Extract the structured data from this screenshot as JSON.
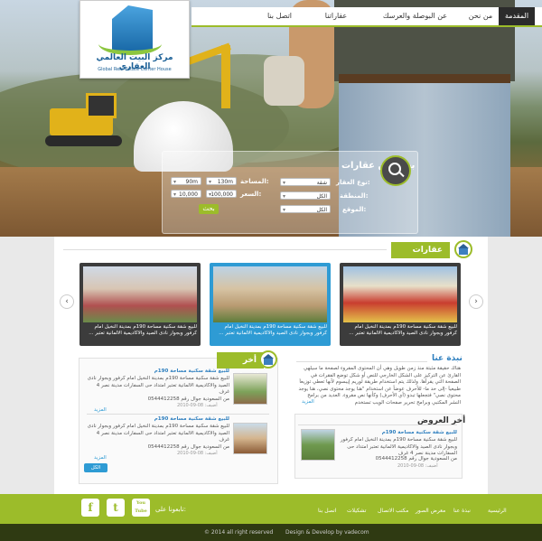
{
  "nav": {
    "items": [
      "المقدمة",
      "من نحن",
      "عن البوصلة والعرسك",
      "عقاراتنا",
      "اتصل بنا"
    ],
    "active": 0
  },
  "logo": {
    "arabic": "مركز البيت العالمي العقاري",
    "english": "Global Real Estate Center House"
  },
  "search": {
    "title": "بحث عن عقارات",
    "type_label": "نوع العقار:",
    "type_value": "شقة",
    "area_label": "المنطقة:",
    "area_value": "الكل",
    "location_label": "الموقع:",
    "location_value": "الكل",
    "space_label": "المساحة:",
    "space_from": "130m",
    "space_to": "90m",
    "price_label": "السعر:",
    "price_from": "100,000",
    "price_to": "10,000",
    "button": "بحث"
  },
  "featured": {
    "title": "عقارات مميزة",
    "cards": [
      {
        "text": "للبيع شقة سكنية مساحة 190م بمدينة النخيل امام كرفور وبجوار نادى الصيد والاكاديمية الالمانية تعتبر ..."
      },
      {
        "text": "للبيع شقة سكنية مساحة 190م بمدينة النخيل امام كرفور وبجوار نادى الصيد والاكاديمية الالمانية تعتبر ..."
      },
      {
        "text": "للبيع شقة سكنية مساحة 190م بمدينة النخيل امام كرفور وبجوار نادى الصيد والاكاديمية الالمانية تعتبر ..."
      }
    ],
    "prev": "‹",
    "next": "›"
  },
  "latest": {
    "title": "أخر العقارات",
    "items": [
      {
        "title": "للبيع شقة سكنية مساحة 190م",
        "text": "للبيع شقة سكنية مساحة 190م بمدينة النخيل امام كرفور وبجوار نادى الصيد والاكاديمية الالمانية تعتبر امتداد حى السفارات مدينة نصر 4 غرف",
        "phone": "من السعودية جوال رقم 0544412258",
        "date": "2010-09-08 :أضيف",
        "more": "المزيد"
      },
      {
        "title": "للبيع شقة سكنية مساحة 190م",
        "text": "للبيع شقة سكنية مساحة 190م بمدينة النخيل امام كرفور وبجوار نادى الصيد والاكاديمية الالمانية تعتبر امتداد حى السفارات مدينة نصر 4 غرف",
        "phone": "من السعودية جوال رقم 0544412258",
        "date": "2010-09-08 :أضيف",
        "more": "المزيد"
      }
    ],
    "all_button": "الكل"
  },
  "about": {
    "title": "نبذة عنا",
    "text": "هناك حقيقة مثبتة منذ زمن طويل وهي أن المحتوى المقروء لصفحة ما سيلهي القارئ عن التركيز على الشكل الخارجي للنص أو شكل توضع الفقرات في الصفحة التي يقرأها. ولذلك يتم استخدام طريقة لوريم إيبسوم لأنها تعطي توزيعاَ طبيعياَ -إلى حد ما- للأحرف عوضاً عن استخدام \"هنا يوجد محتوى نصي، هنا يوجد محتوى نصي\" فتجعلها تبدو (أي الأحرف) وكأنها نص مقروء. العديد من برامح النشر المكتبي وبرامح تحرير صفحات الويب تستخدم",
    "more": "المزيد"
  },
  "offers": {
    "title": "أخر العروض",
    "item_title": "للبيع شقة سكنية مساحة 190م",
    "item_text": "للبيع شقة سكنية مساحة 190م بمدينة النخيل امام كرفور وبجوار نادى الصيد والاكاديمية الالمانية تعتبر امتداد حى السفارات مدينة نصر 4 غرف",
    "phone": "من السعودية جوال رقم 0544412258",
    "date": "2010-09-08 :أضيف"
  },
  "footer": {
    "follow": "تابعونا على:",
    "links": [
      "الرئيسية",
      "نبذة عنا",
      "معرض الصور",
      "مكتب الاتصال",
      "تشكيلات",
      "اتصل بنا"
    ],
    "copyright": "© 2014  all right reserved",
    "credit": "Design & Develop by vadecom",
    "social": [
      "f",
      "t",
      "You Tube"
    ]
  },
  "colors": {
    "accent": "#9cbc2a",
    "blue": "#2e9bd4",
    "dark": "#2f3a12"
  }
}
